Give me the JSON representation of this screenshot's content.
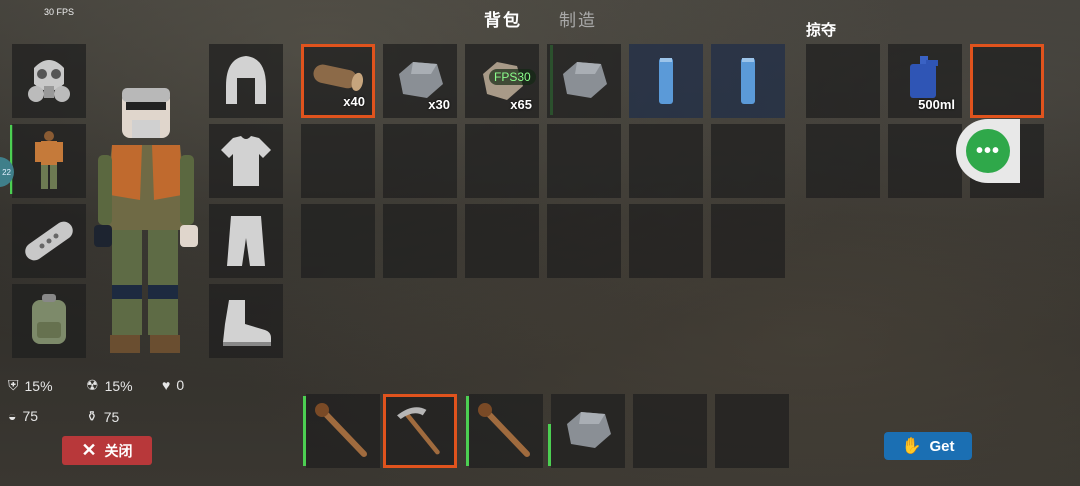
{
  "hud": {
    "fps_label": "30 FPS"
  },
  "tabs": [
    {
      "label": "背包",
      "active": true
    },
    {
      "label": "制造",
      "active": false
    }
  ],
  "loot": {
    "title": "掠夺"
  },
  "character_stats": {
    "armor": "15%",
    "radiation": "15%",
    "health": "0",
    "food": "75",
    "water": "75"
  },
  "backpack": {
    "slots": [
      {
        "item": "wood-log",
        "qty": "x40",
        "selected": true
      },
      {
        "item": "stone",
        "qty": "x30"
      },
      {
        "item": "stone",
        "qty": "x65",
        "badge": "FPS30"
      },
      {
        "item": "stone",
        "qty": "",
        "marker": "green"
      },
      {
        "item": "soda-can",
        "qty": ""
      },
      {
        "item": "soda-can",
        "qty": ""
      }
    ]
  },
  "loot_slots": [
    {
      "item": "",
      "qty": ""
    },
    {
      "item": "water-jug",
      "qty": "500ml"
    },
    {
      "item": "",
      "qty": "",
      "selected": true
    }
  ],
  "hotbar": [
    {
      "item": "torch"
    },
    {
      "item": "pickaxe",
      "selected": true
    },
    {
      "item": "torch"
    },
    {
      "item": "stone"
    },
    {
      "item": ""
    }
  ],
  "buttons": {
    "close_label": "关闭",
    "get_label": "Get"
  },
  "colors": {
    "selection_orange": "#e0531d",
    "marker_green": "#4ccf52",
    "close_red": "#b8383a",
    "get_blue": "#1b6fb3",
    "chat_green": "#2fa84a"
  }
}
